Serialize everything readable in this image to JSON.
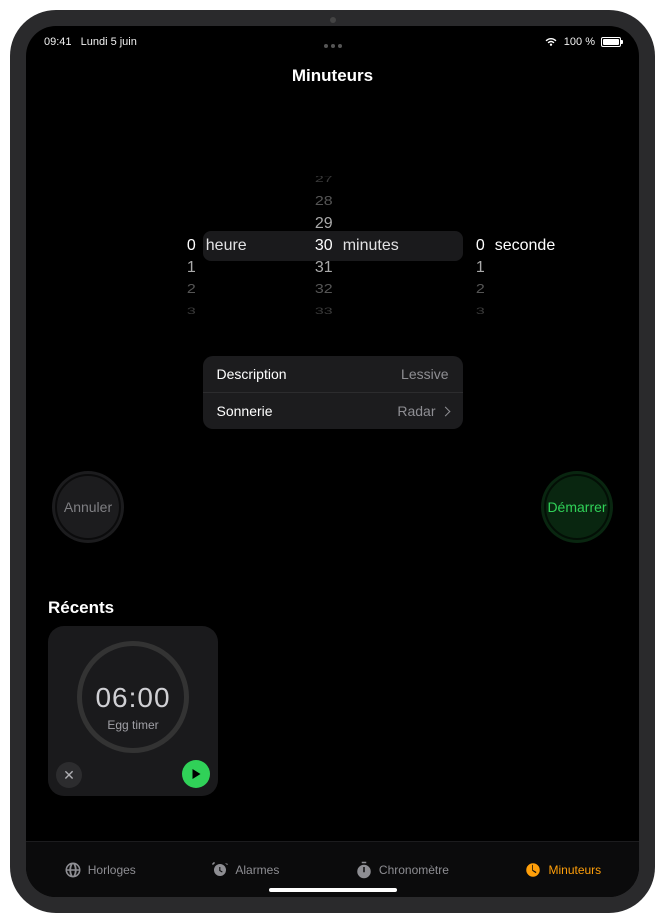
{
  "status": {
    "time": "09:41",
    "date": "Lundi 5 juin",
    "battery_pct": "100 %"
  },
  "title": "Minuteurs",
  "picker": {
    "hours": {
      "selected": "0",
      "unit": "heure",
      "above": [
        "",
        "",
        "",
        ""
      ],
      "below": [
        "1",
        "2",
        "3",
        ""
      ]
    },
    "minutes": {
      "selected": "30",
      "unit": "minutes",
      "above": [
        "27",
        "28",
        "29"
      ],
      "below": [
        "31",
        "32",
        "33"
      ]
    },
    "seconds": {
      "selected": "0",
      "unit": "seconde",
      "above": [
        "",
        "",
        "",
        ""
      ],
      "below": [
        "1",
        "2",
        "3",
        ""
      ]
    }
  },
  "settings": {
    "description_label": "Description",
    "description_value": "Lessive",
    "sound_label": "Sonnerie",
    "sound_value": "Radar"
  },
  "buttons": {
    "cancel": "Annuler",
    "start": "Démarrer"
  },
  "recents": {
    "heading": "Récents",
    "item": {
      "time": "06:00",
      "label": "Egg timer"
    }
  },
  "tabs": {
    "worldclock": "Horloges",
    "alarms": "Alarmes",
    "stopwatch": "Chronomètre",
    "timers": "Minuteurs"
  }
}
